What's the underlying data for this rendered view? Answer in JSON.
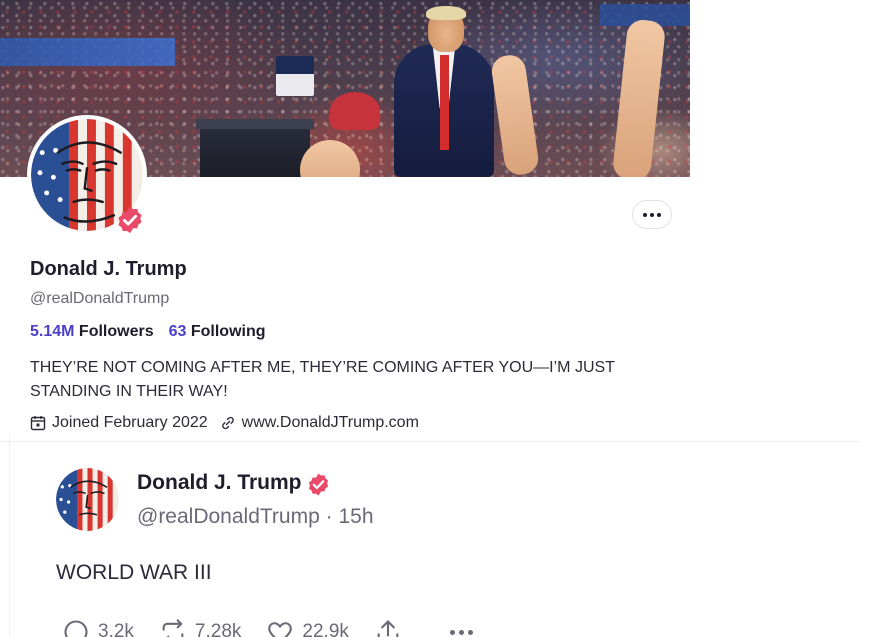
{
  "profile": {
    "display_name": "Donald J. Trump",
    "handle": "@realDonaldTrump",
    "followers_count": "5.14M",
    "followers_label": "Followers",
    "following_count": "63",
    "following_label": "Following",
    "bio": "THEY’RE NOT COMING AFTER ME, THEY’RE COMING AFTER YOU—I’M JUST STANDING IN THEIR WAY!",
    "joined": "Joined February 2022",
    "website": "www.DonaldJTrump.com",
    "icons": {
      "more": "more-options-icon",
      "verified": "verified-badge-icon",
      "calendar": "calendar-icon",
      "link": "link-icon"
    }
  },
  "post": {
    "author_name": "Donald J. Trump",
    "author_handle": "@realDonaldTrump",
    "separator": "·",
    "time": "15h",
    "text": "WORLD WAR III",
    "replies": "3.2k",
    "retruths": "7.28k",
    "likes": "22.9k",
    "icons": {
      "reply": "reply-icon",
      "retruth": "repost-icon",
      "like": "heart-icon",
      "share": "share-icon",
      "more": "more-options-icon"
    }
  },
  "colors": {
    "accent_blue": "#4a3fc7",
    "verified_badge": "#ea4a6a",
    "text_primary": "#1f1d2b",
    "text_secondary": "#6b6878"
  }
}
